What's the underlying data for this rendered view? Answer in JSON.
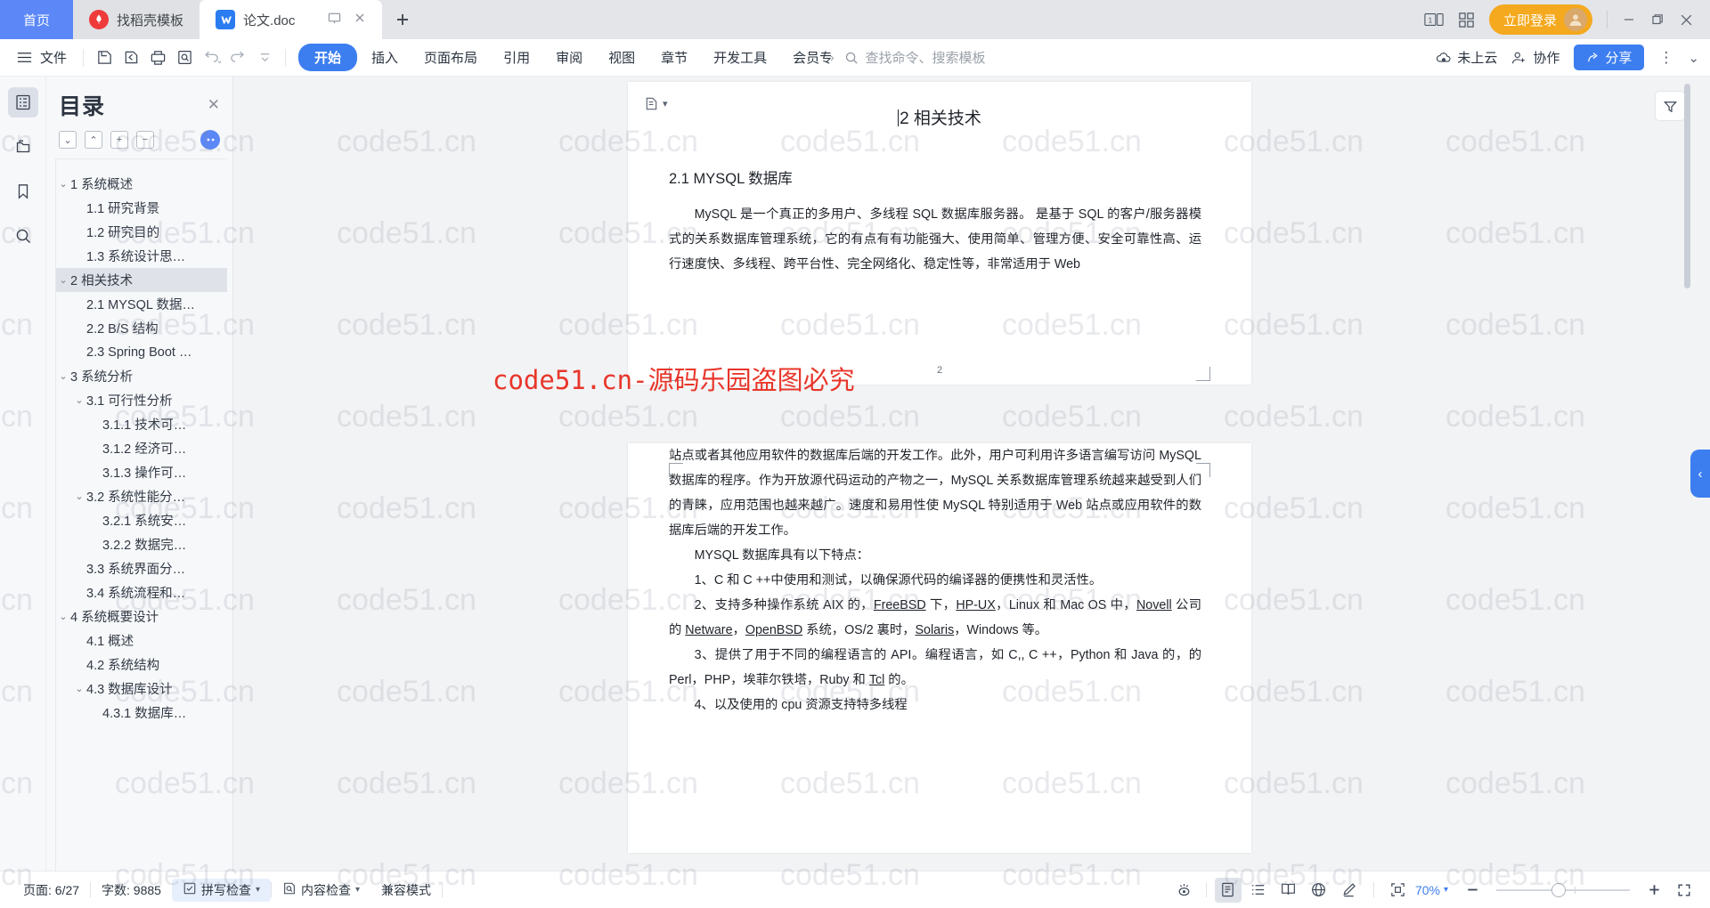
{
  "window": {
    "tabs": [
      {
        "label": "首页",
        "type": "home",
        "icon": "home-tab"
      },
      {
        "label": "找稻壳模板",
        "type": "inactive",
        "icon": "docer-icon"
      },
      {
        "label": "论文.doc",
        "type": "active",
        "icon": "wps-writer-icon"
      }
    ],
    "new_tab_label": "+",
    "controls": {
      "page_count_icon": "one-page-icon",
      "grid_icon": "grid-view-icon",
      "login_label": "立即登录",
      "minimize": "−",
      "maximize": "❐",
      "close": "✕"
    }
  },
  "ribbon": {
    "file_label": "文件",
    "quick_tools": [
      "save-icon",
      "save-as-icon",
      "print-icon",
      "print-preview-icon",
      "undo-icon",
      "redo-icon",
      "customize-icon"
    ],
    "menus": [
      {
        "label": "开始",
        "active": true
      },
      {
        "label": "插入",
        "active": false
      },
      {
        "label": "页面布局",
        "active": false
      },
      {
        "label": "引用",
        "active": false
      },
      {
        "label": "审阅",
        "active": false
      },
      {
        "label": "视图",
        "active": false
      },
      {
        "label": "章节",
        "active": false
      },
      {
        "label": "开发工具",
        "active": false
      },
      {
        "label": "会员专享",
        "active": false
      }
    ],
    "more_chevron": "›",
    "search_placeholder": "查找命令、搜索模板",
    "cloud_label": "未上云",
    "collab_label": "协作",
    "share_label": "分享",
    "more_label": "⋮",
    "collapse_label": "⌄"
  },
  "sidebar": {
    "rail": [
      {
        "name": "outline-icon",
        "selected": true
      },
      {
        "name": "thumbnail-icon",
        "selected": false
      },
      {
        "name": "bookmark-icon",
        "selected": false
      },
      {
        "name": "search-icon",
        "selected": false
      }
    ],
    "title": "目录",
    "close": "✕",
    "tools": [
      {
        "name": "expand-down-button",
        "glyph": "⌄"
      },
      {
        "name": "collapse-up-button",
        "glyph": "⌃"
      },
      {
        "name": "add-level-button",
        "glyph": "+"
      },
      {
        "name": "remove-level-button",
        "glyph": "−"
      }
    ],
    "items": [
      {
        "label": "1 系统概述",
        "level": 1,
        "arrow": "⌄",
        "selected": false
      },
      {
        "label": "1.1  研究背景",
        "level": 2,
        "arrow": "",
        "selected": false
      },
      {
        "label": "1.2 研究目的",
        "level": 2,
        "arrow": "",
        "selected": false
      },
      {
        "label": "1.3 系统设计思…",
        "level": 2,
        "arrow": "",
        "selected": false
      },
      {
        "label": "2 相关技术",
        "level": 1,
        "arrow": "⌄",
        "selected": true
      },
      {
        "label": "2.1 MYSQL 数据…",
        "level": 2,
        "arrow": "",
        "selected": false
      },
      {
        "label": "2.2 B/S 结构",
        "level": 2,
        "arrow": "",
        "selected": false
      },
      {
        "label": "2.3 Spring Boot …",
        "level": 2,
        "arrow": "",
        "selected": false
      },
      {
        "label": "3 系统分析",
        "level": 1,
        "arrow": "⌄",
        "selected": false
      },
      {
        "label": "3.1 可行性分析",
        "level": 2,
        "arrow": "⌄",
        "selected": false
      },
      {
        "label": "3.1.1 技术可…",
        "level": 3,
        "arrow": "",
        "selected": false
      },
      {
        "label": "3.1.2 经济可…",
        "level": 3,
        "arrow": "",
        "selected": false
      },
      {
        "label": "3.1.3 操作可…",
        "level": 3,
        "arrow": "",
        "selected": false
      },
      {
        "label": "3.2 系统性能分…",
        "level": 2,
        "arrow": "⌄",
        "selected": false
      },
      {
        "label": "3.2.1  系统安…",
        "level": 3,
        "arrow": "",
        "selected": false
      },
      {
        "label": "3.2.2  数据完…",
        "level": 3,
        "arrow": "",
        "selected": false
      },
      {
        "label": "3.3 系统界面分…",
        "level": 2,
        "arrow": "",
        "selected": false
      },
      {
        "label": "3.4 系统流程和…",
        "level": 2,
        "arrow": "",
        "selected": false
      },
      {
        "label": "4 系统概要设计",
        "level": 1,
        "arrow": "⌄",
        "selected": false
      },
      {
        "label": "4.1 概述",
        "level": 2,
        "arrow": "",
        "selected": false
      },
      {
        "label": "4.2 系统结构",
        "level": 2,
        "arrow": "",
        "selected": false
      },
      {
        "label": "4.3 数据库设计",
        "level": 2,
        "arrow": "⌄",
        "selected": false
      },
      {
        "label": "4.3.1 数据库…",
        "level": 3,
        "arrow": "",
        "selected": false
      }
    ]
  },
  "document": {
    "page1": {
      "heading": "2 相关技术",
      "section": "2.1 MYSQL 数据库",
      "paragraph": "MySQL 是一个真正的多用户、多线程 SQL 数据库服务器。 是基于 SQL 的客户/服务器模式的关系数据库管理系统，它的有点有有功能强大、使用简单、管理方便、安全可靠性高、运行速度快、多线程、跨平台性、完全网络化、稳定性等，非常适用于 Web",
      "page_number": "2"
    },
    "page2": {
      "p1": "站点或者其他应用软件的数据库后端的开发工作。此外，用户可利用许多语言编写访问 MySQL 数据库的程序。作为开放源代码运动的产物之一，MySQL 关系数据库管理系统越来越受到人们的青睐，应用范围也越来越广。速度和易用性使 MySQL 特别适用于 Web 站点或应用软件的数据库后端的开发工作。",
      "p2": "MYSQL 数据库具有以下特点：",
      "p3": "1、C 和 C ++中使用和测试，以确保源代码的编译器的便携性和灵活性。",
      "p4_a": "2、支持多种操作系统 AIX 的，",
      "p4_u1": "FreeBSD",
      "p4_b": " 下，",
      "p4_u2": "HP-UX",
      "p4_c": "，Linux 和 Mac OS 中，",
      "p4_u3": "Novell",
      "p4_d": " 公司的 ",
      "p4_u4": "Netware",
      "p4_e": "，",
      "p4_u5": "OpenBSD",
      "p4_f": " 系统，OS/2 裏时，",
      "p4_u6": "Solaris",
      "p4_g": "，Windows 等。",
      "p5": "3、提供了用于不同的编程语言的 API。编程语言，如 C,, C ++，Python 和 Java 的，的 Perl，PHP，埃菲尔铁塔，Ruby 和 ",
      "p5_u": "Tcl",
      "p5_b": " 的。",
      "p6": "4、以及使用的 cpu 资源支持特多线程"
    }
  },
  "right_panel": {
    "filter_icon": "filter-button",
    "drawer_handle": "‹"
  },
  "status_bar": {
    "page_label": "页面: 6/27",
    "word_count_label": "字数: 9885",
    "spell_check_label": "拼写检查",
    "content_check_label": "内容检查",
    "compat_mode_label": "兼容模式",
    "view_buttons": [
      {
        "name": "eye-care-icon",
        "selected": false
      },
      {
        "name": "page-view-icon",
        "selected": true
      },
      {
        "name": "outline-view-icon",
        "selected": false
      },
      {
        "name": "reading-view-icon",
        "selected": false
      },
      {
        "name": "web-view-icon",
        "selected": false
      },
      {
        "name": "edit-pen-icon",
        "selected": false
      }
    ],
    "fit_icon": "fit-page-icon",
    "zoom_level": "70%",
    "zoom_out": "−",
    "zoom_in": "+",
    "fullscreen_icon": "fullscreen-icon"
  },
  "watermark": {
    "tile_text": "code51.cn",
    "banner_text": "code51.cn-源码乐园盗图必究",
    "banner_color": "#e8362a"
  },
  "theme": {
    "accent": "#3c7ef0",
    "home_tab": "#5b87f7",
    "login": "#f4a91e",
    "selected_row": "#dfe3e9"
  }
}
